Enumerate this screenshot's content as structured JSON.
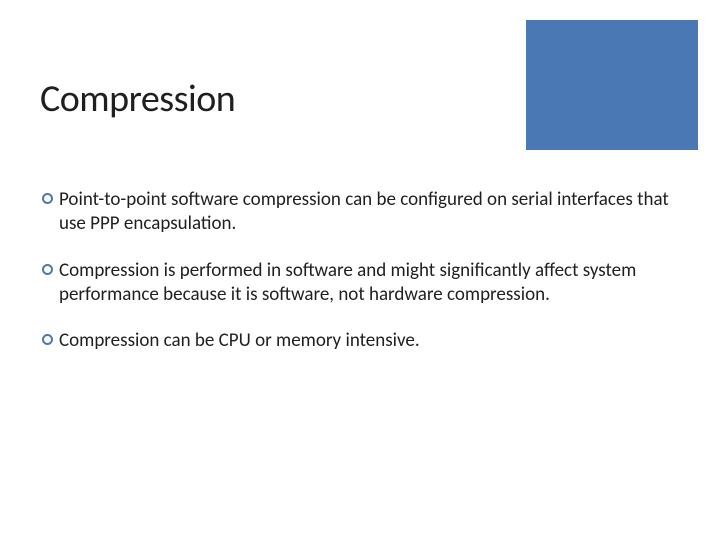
{
  "slide": {
    "title": "Compression",
    "bullets": [
      "Point-to-point software compression can be configured on serial interfaces that use PPP encapsulation.",
      "Compression is performed in software and might significantly affect system performance because it is software, not hardware compression.",
      "Compression can be CPU or memory intensive."
    ]
  },
  "colors": {
    "accent": "#4a78b4"
  }
}
